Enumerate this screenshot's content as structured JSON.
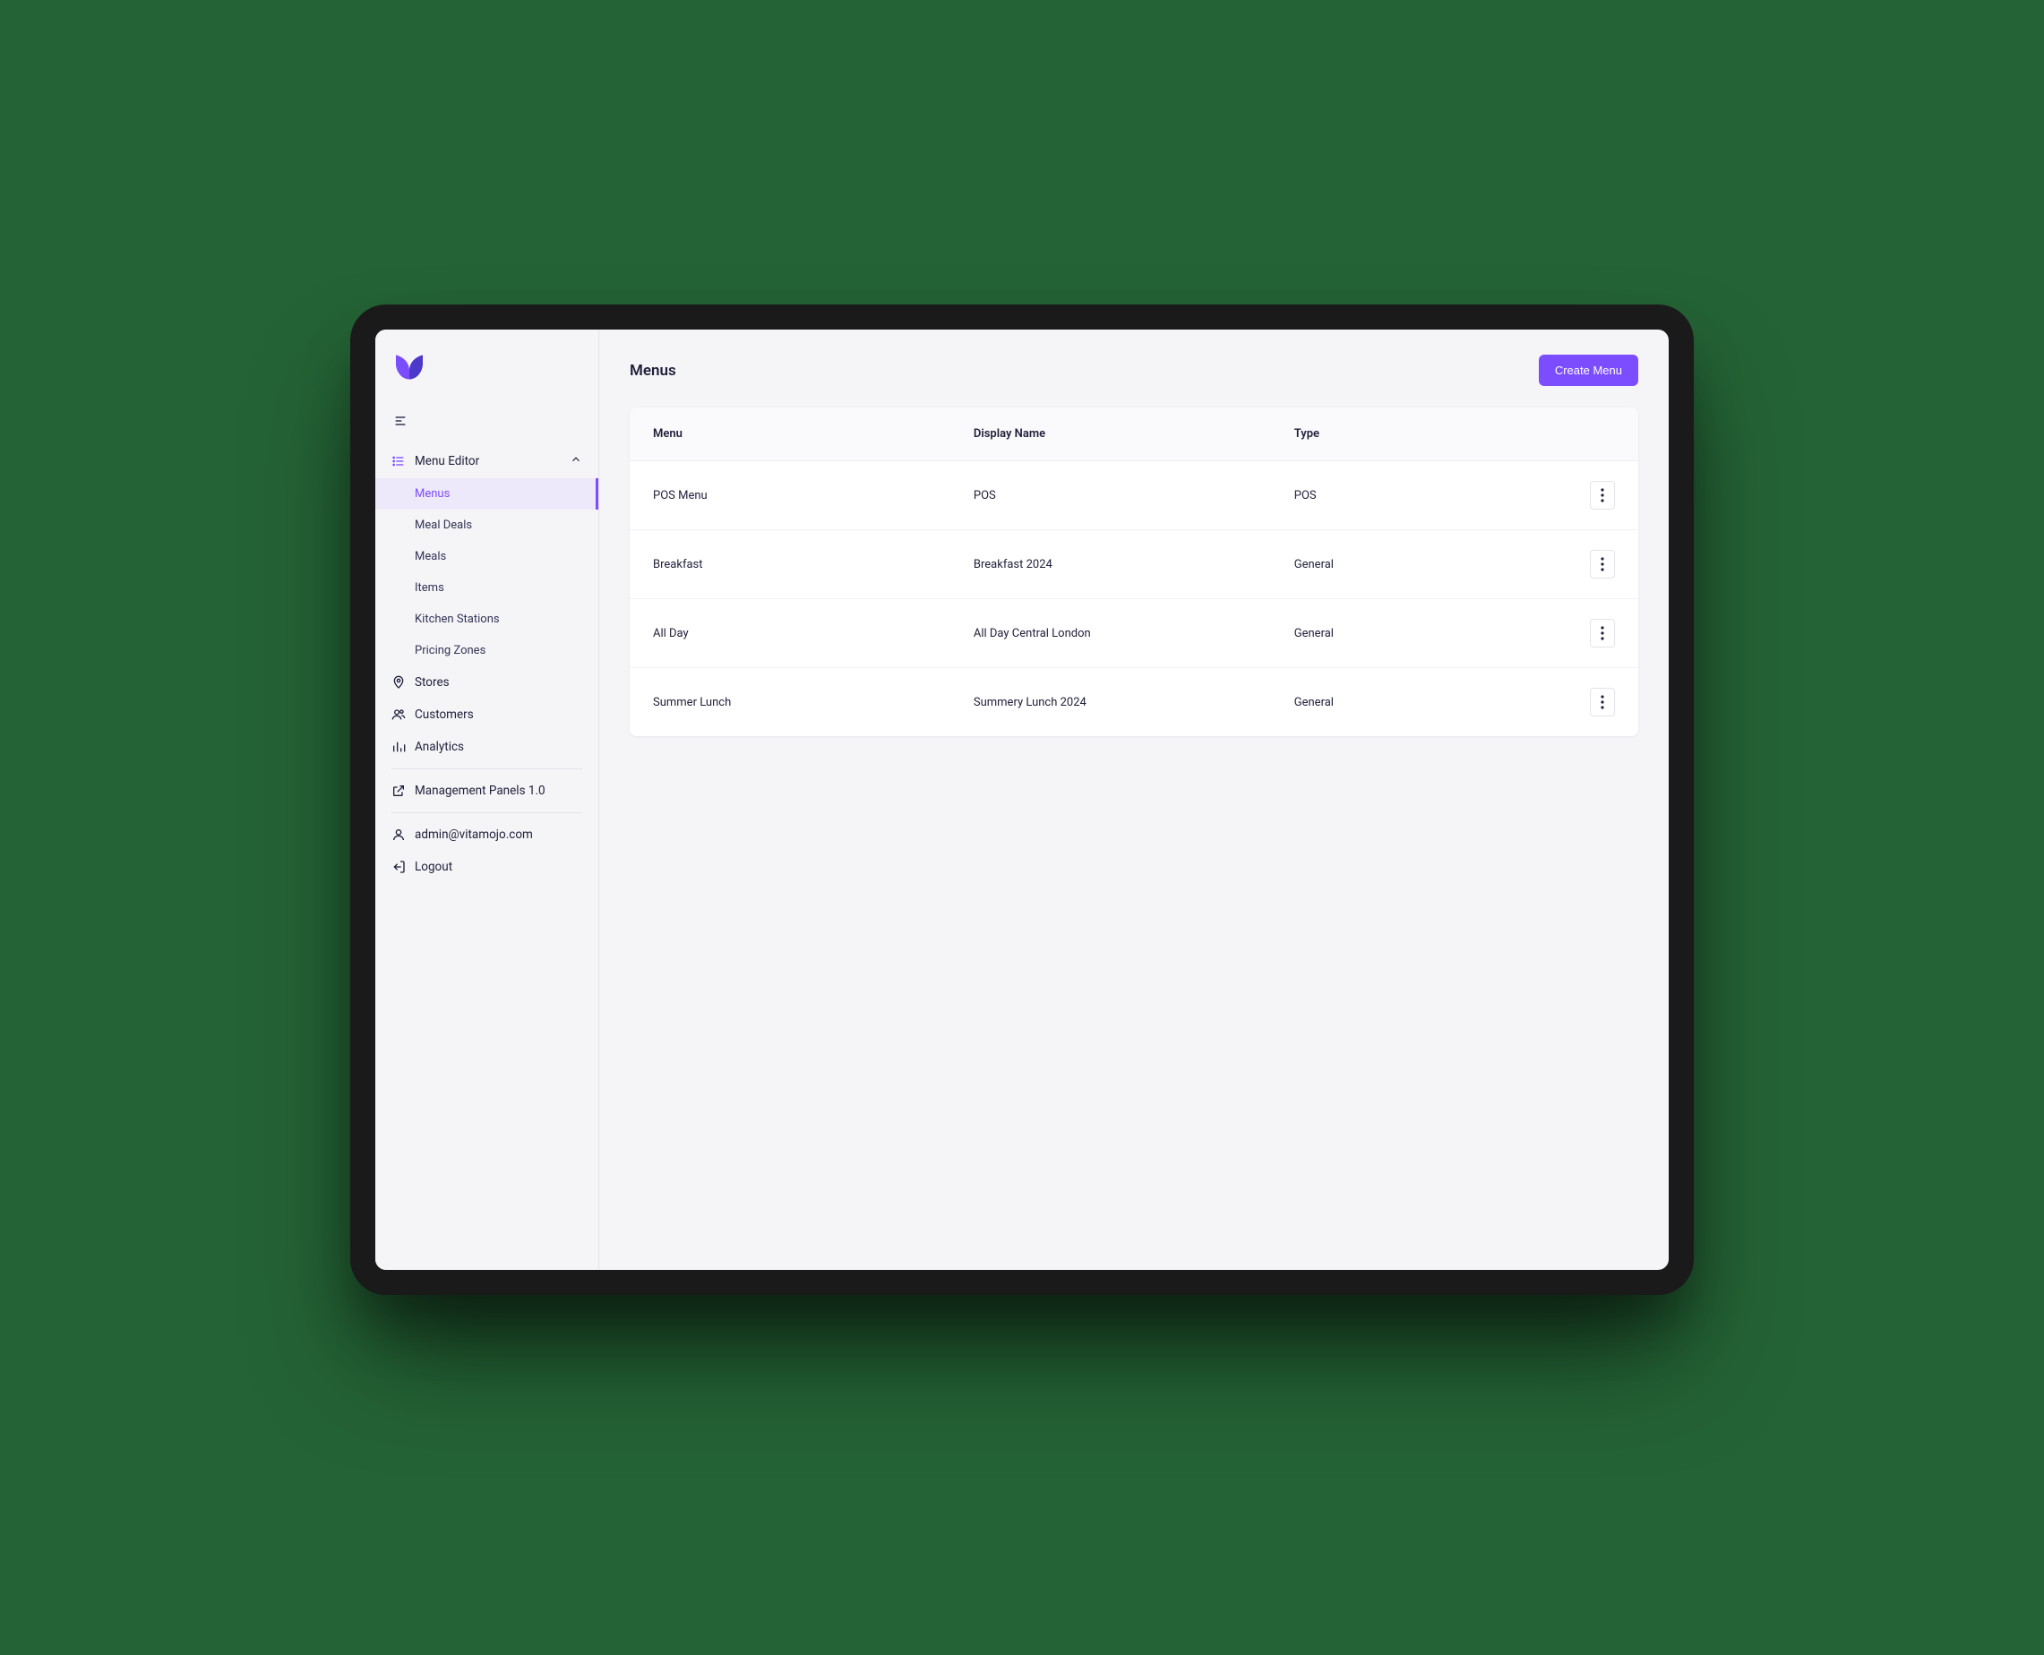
{
  "colors": {
    "accent": "#7c4dff"
  },
  "sidebar": {
    "menu_editor": {
      "label": "Menu Editor",
      "expanded": true
    },
    "submenus": [
      {
        "label": "Menus",
        "active": true
      },
      {
        "label": "Meal Deals",
        "active": false
      },
      {
        "label": "Meals",
        "active": false
      },
      {
        "label": "Items",
        "active": false
      },
      {
        "label": "Kitchen Stations",
        "active": false
      },
      {
        "label": "Pricing Zones",
        "active": false
      }
    ],
    "stores": "Stores",
    "customers": "Customers",
    "analytics": "Analytics",
    "management_panels": "Management Panels 1.0",
    "user_email": "admin@vitamojo.com",
    "logout": "Logout"
  },
  "header": {
    "title": "Menus",
    "create_button": "Create Menu"
  },
  "table": {
    "columns": {
      "menu": "Menu",
      "display_name": "Display Name",
      "type": "Type"
    },
    "rows": [
      {
        "menu": "POS Menu",
        "display_name": "POS",
        "type": "POS"
      },
      {
        "menu": "Breakfast",
        "display_name": "Breakfast 2024",
        "type": "General"
      },
      {
        "menu": "All Day",
        "display_name": "All Day Central London",
        "type": "General"
      },
      {
        "menu": "Summer Lunch",
        "display_name": "Summery Lunch 2024",
        "type": "General"
      }
    ]
  }
}
